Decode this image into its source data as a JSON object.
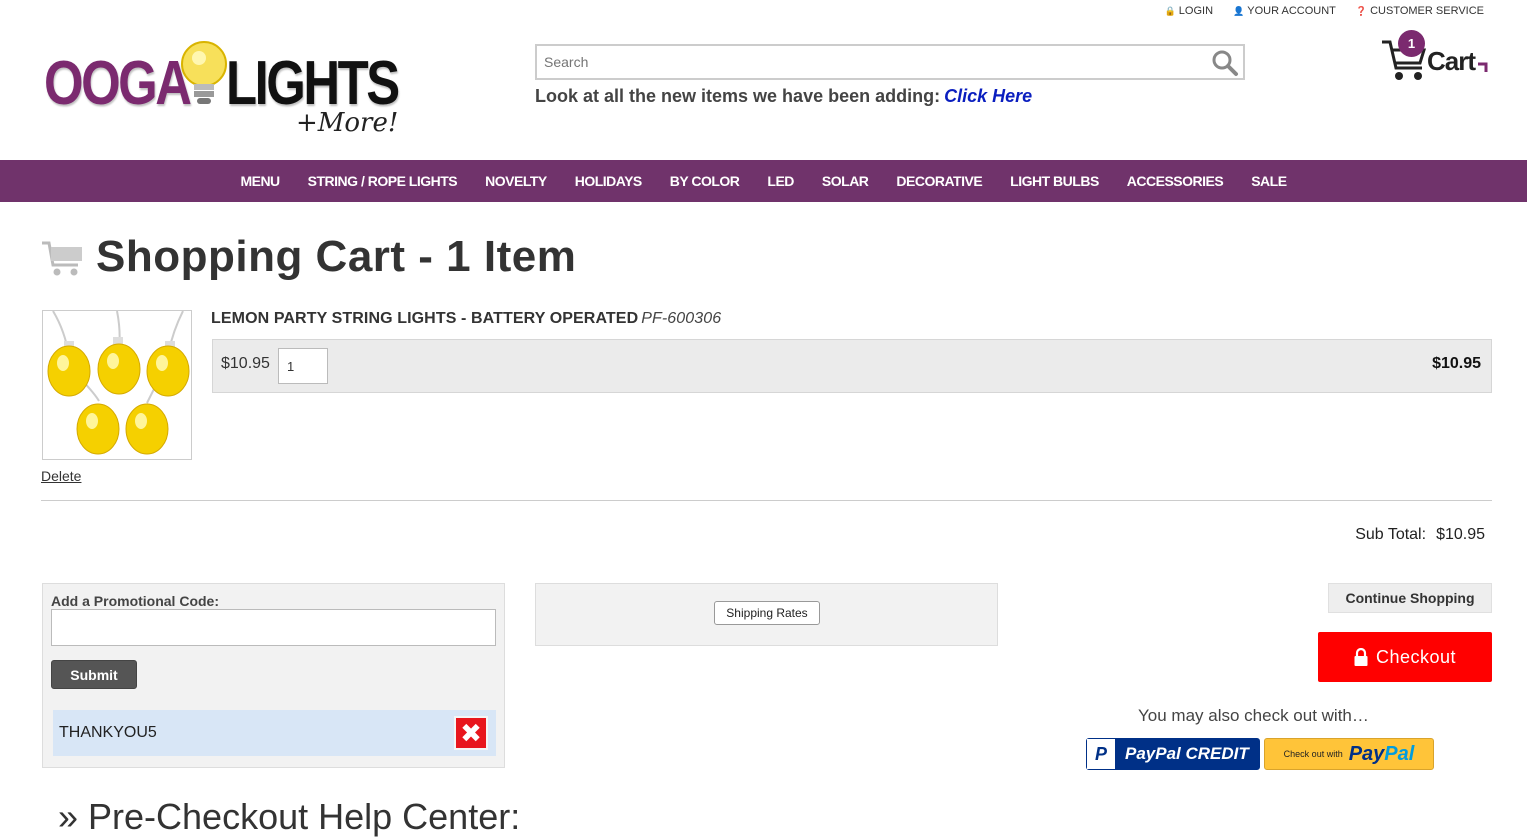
{
  "top_links": {
    "login": "LOGIN",
    "account": "YOUR ACCOUNT",
    "service": "CUSTOMER SERVICE"
  },
  "logo": {
    "word1": "OOGA",
    "word2": "LIGHTS",
    "tagline": "+More!"
  },
  "search": {
    "placeholder": "Search"
  },
  "promo_banner": {
    "text": "Look at all the new items we have been adding:",
    "link": "Click Here"
  },
  "cart_widget": {
    "count": "1",
    "label": "Cart"
  },
  "nav": [
    "MENU",
    "STRING / ROPE LIGHTS",
    "NOVELTY",
    "HOLIDAYS",
    "BY COLOR",
    "LED",
    "SOLAR",
    "DECORATIVE",
    "LIGHT BULBS",
    "ACCESSORIES",
    "SALE"
  ],
  "page_title": "Shopping Cart - 1 Item",
  "item": {
    "name": "LEMON PARTY STRING LIGHTS - BATTERY OPERATED",
    "sku": "PF-600306",
    "unit_price": "$10.95",
    "quantity": "1",
    "line_total": "$10.95",
    "delete": "Delete"
  },
  "subtotal": {
    "label": "Sub Total:",
    "value": "$10.95"
  },
  "promo": {
    "label": "Add a Promotional Code:",
    "submit": "Submit",
    "applied_code": "THANKYOU5"
  },
  "shipping": {
    "button": "Shipping Rates"
  },
  "actions": {
    "continue": "Continue Shopping",
    "checkout": "Checkout",
    "also": "You may also check out with…"
  },
  "paypal": {
    "credit": "PayPal CREDIT",
    "checkout_small": "Check out with",
    "checkout_pay": "Pay",
    "checkout_pal": "Pal"
  },
  "help_title": "» Pre-Checkout Help Center:",
  "colors": {
    "nav_bg": "#70336b",
    "brand_purple": "#7b2a6f",
    "checkout_red": "#ff0000",
    "link_blue": "#0a1ebf"
  }
}
